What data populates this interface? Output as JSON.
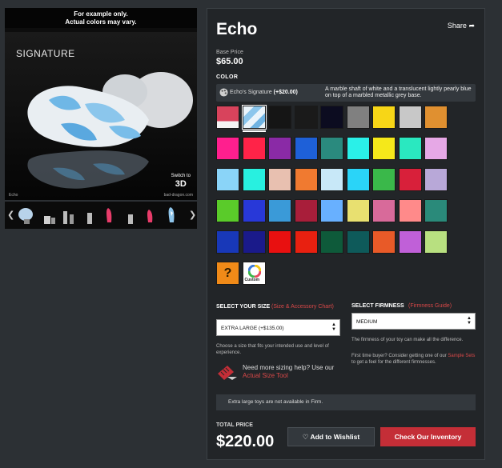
{
  "gallery": {
    "notice_line1": "For example only.",
    "notice_line2": "Actual colors may vary.",
    "brand": "SIGNATURE",
    "switch_small": "Switch to",
    "switch_big": "3D",
    "caption": "Echo",
    "site": "bad-dragon.com",
    "prev_icon": "chevron-left-icon",
    "next_icon": "chevron-right-icon"
  },
  "product": {
    "title": "Echo",
    "share": "Share",
    "base_price_label": "Base Price",
    "base_price": "$65.00"
  },
  "color": {
    "label": "COLOR",
    "selected_name": "Echo's Signature",
    "selected_price": "(+$20.00)",
    "selected_description": "A marble shaft of white and a translucent lightly pearly blue on top of a marbled metallic grey base.",
    "swatches": [
      [
        "#d8435c",
        "#b7d7ee",
        "#151515",
        "#1a1a1a",
        "#0c0c20",
        "#808080",
        "#f7d617",
        "#c8c8c8",
        "#e09030"
      ],
      [
        "#ff1f8e",
        "#ff2348",
        "#8a2aa6",
        "#1e60d8",
        "#2a8a7e",
        "#2af0e8",
        "#f5e81a",
        "#2ae8c0",
        "#e6a8e6"
      ],
      [
        "#8ad4f8",
        "#28f0e0",
        "#e8c0b0",
        "#f07a30",
        "#c8e8f8",
        "#2ad4f8",
        "#3ab84a",
        "#d8203a",
        "#b8a8d8"
      ],
      [
        "#5acb2a",
        "#2838d8",
        "#3a9ad8",
        "#a81e3a",
        "#68b0ff",
        "#e8e070",
        "#d86a9a",
        "#ff8a8a",
        "#2a8a7a"
      ],
      [
        "#1838b8",
        "#1a1a8a",
        "#e81010",
        "#e82010",
        "#0e5a3a",
        "#0e5a5a",
        "#e85a28",
        "#c060d8",
        "#b8e080"
      ],
      [
        "#f08a18",
        "#ffffff"
      ]
    ],
    "custom_label": "Custom"
  },
  "size": {
    "label": "SELECT YOUR SIZE",
    "guide": "(Size & Accessory Chart)",
    "value": "EXTRA LARGE (+$135.00)",
    "help": "Choose a size that fits your intended use and level of experience.",
    "more_help": "Need more sizing help? Use our",
    "tool_link": "Actual Size Tool"
  },
  "firmness": {
    "label": "SELECT FIRMNESS",
    "guide": "(Firmness Guide)",
    "value": "MEDIUM",
    "help1": "The firmness of your toy can make all the difference.",
    "help2_pre": "First time buyer? Consider getting one of our",
    "help2_link": "Sample Sets",
    "help2_post": "to get a feel for the different firmnesses."
  },
  "warning": "Extra large toys are not available in Firm.",
  "total": {
    "label": "TOTAL PRICE",
    "price": "$220.00"
  },
  "actions": {
    "wishlist": "Add to Wishlist",
    "checkout": "Check Our Inventory"
  },
  "colors": {
    "accent_red": "#c42e37",
    "link_red": "#d94848",
    "panel_bg": "#222528",
    "page_bg": "#2c3034"
  }
}
